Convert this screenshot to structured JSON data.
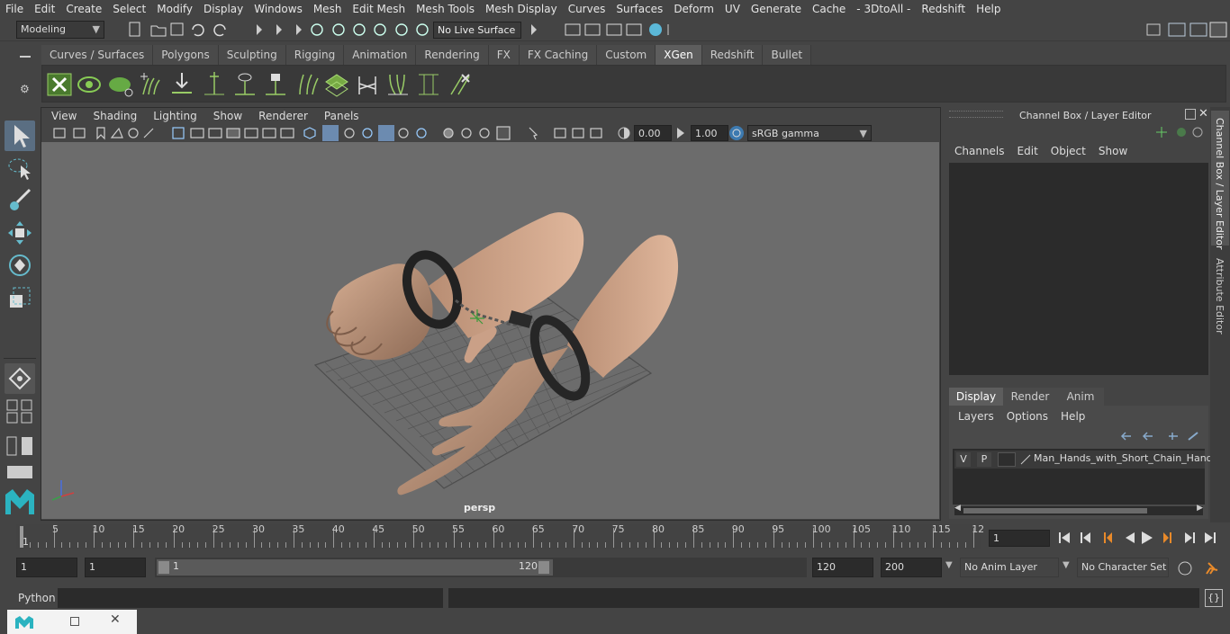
{
  "menubar": {
    "items": [
      "File",
      "Edit",
      "Create",
      "Select",
      "Modify",
      "Display",
      "Windows",
      "Mesh",
      "Edit Mesh",
      "Mesh Tools",
      "Mesh Display",
      "Curves",
      "Surfaces",
      "Deform",
      "UV",
      "Generate",
      "Cache",
      "- 3DtoAll -",
      "Redshift",
      "Help"
    ]
  },
  "status": {
    "mode": "Modeling",
    "live_surface": "No Live Surface"
  },
  "shelf": {
    "tabs": [
      "Curves / Surfaces",
      "Polygons",
      "Sculpting",
      "Rigging",
      "Animation",
      "Rendering",
      "FX",
      "FX Caching",
      "Custom",
      "XGen",
      "Redshift",
      "Bullet"
    ],
    "active": "XGen"
  },
  "viewport": {
    "menu": [
      "View",
      "Shading",
      "Lighting",
      "Show",
      "Renderer",
      "Panels"
    ],
    "exposure": "0.00",
    "gamma": "1.00",
    "color_space": "sRGB gamma",
    "camera_label": "persp"
  },
  "channel_box": {
    "title": "Channel Box / Layer Editor",
    "menu": [
      "Channels",
      "Edit",
      "Object",
      "Show"
    ],
    "layer_tabs": [
      "Display",
      "Render",
      "Anim"
    ],
    "active_layer_tab": "Display",
    "layer_menu": [
      "Layers",
      "Options",
      "Help"
    ],
    "layer": {
      "v": "V",
      "p": "P",
      "name": "Man_Hands_with_Short_Chain_Hand"
    }
  },
  "side_tabs": [
    "Channel Box / Layer Editor",
    "Attribute Editor"
  ],
  "timeline": {
    "ticks": [
      "5",
      "10",
      "15",
      "20",
      "25",
      "30",
      "35",
      "40",
      "45",
      "50",
      "55",
      "60",
      "65",
      "70",
      "75",
      "80",
      "85",
      "90",
      "95",
      "100",
      "105",
      "110",
      "115",
      "12"
    ],
    "start_label": "1",
    "current_frame": "1"
  },
  "range": {
    "start": "1",
    "playback_start": "1",
    "slider_start": "1",
    "slider_end": "120",
    "playback_end": "120",
    "end": "200",
    "anim_layer": "No Anim Layer",
    "character_set": "No Character Set"
  },
  "command_line": {
    "label": "Python"
  }
}
